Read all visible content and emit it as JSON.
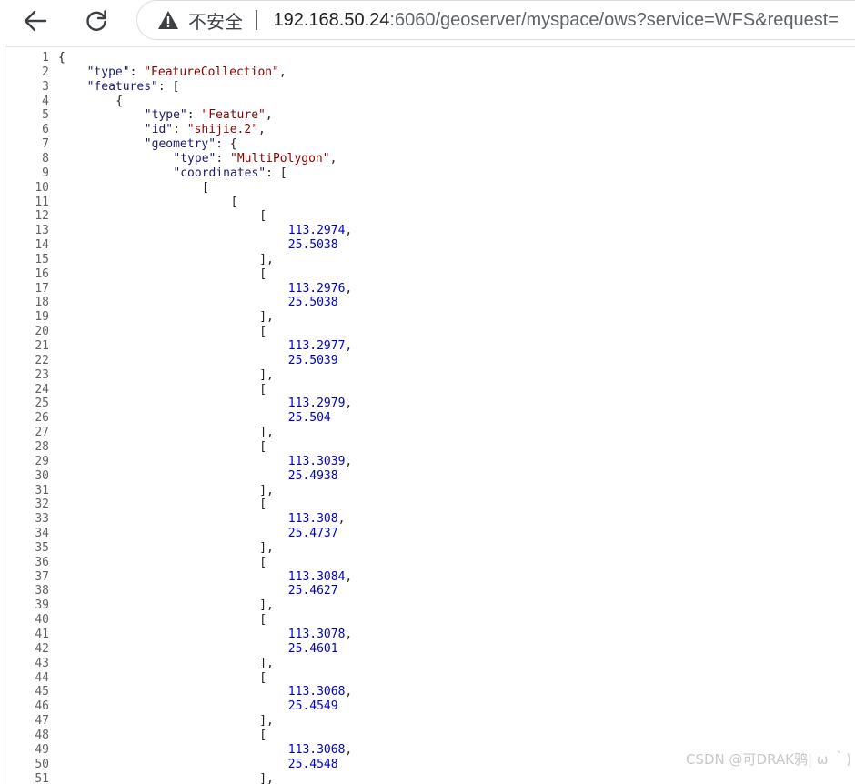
{
  "toolbar": {
    "back_icon": "arrow-left-icon",
    "reload_icon": "reload-icon",
    "security_icon": "warning-triangle-icon",
    "security_label": "不安全",
    "url_host": "192.168.50.24",
    "url_rest": ":6060/geoserver/myspace/ows?service=WFS&request="
  },
  "code_lines": [
    {
      "n": "1",
      "i": 0,
      "t": [
        [
          "p",
          "{"
        ]
      ]
    },
    {
      "n": "2",
      "i": 4,
      "t": [
        [
          "k",
          "\"type\""
        ],
        [
          "p",
          ": "
        ],
        [
          "s",
          "\"FeatureCollection\""
        ],
        [
          "p",
          ","
        ]
      ]
    },
    {
      "n": "3",
      "i": 4,
      "t": [
        [
          "k",
          "\"features\""
        ],
        [
          "p",
          ": ["
        ]
      ]
    },
    {
      "n": "4",
      "i": 8,
      "t": [
        [
          "p",
          "{"
        ]
      ]
    },
    {
      "n": "5",
      "i": 12,
      "t": [
        [
          "k",
          "\"type\""
        ],
        [
          "p",
          ": "
        ],
        [
          "s",
          "\"Feature\""
        ],
        [
          "p",
          ","
        ]
      ]
    },
    {
      "n": "6",
      "i": 12,
      "t": [
        [
          "k",
          "\"id\""
        ],
        [
          "p",
          ": "
        ],
        [
          "s",
          "\"shijie.2\""
        ],
        [
          "p",
          ","
        ]
      ]
    },
    {
      "n": "7",
      "i": 12,
      "t": [
        [
          "k",
          "\"geometry\""
        ],
        [
          "p",
          ": {"
        ]
      ]
    },
    {
      "n": "8",
      "i": 16,
      "t": [
        [
          "k",
          "\"type\""
        ],
        [
          "p",
          ": "
        ],
        [
          "s",
          "\"MultiPolygon\""
        ],
        [
          "p",
          ","
        ]
      ]
    },
    {
      "n": "9",
      "i": 16,
      "t": [
        [
          "k",
          "\"coordinates\""
        ],
        [
          "p",
          ": ["
        ]
      ]
    },
    {
      "n": "10",
      "i": 20,
      "t": [
        [
          "p",
          "["
        ]
      ]
    },
    {
      "n": "11",
      "i": 24,
      "t": [
        [
          "p",
          "["
        ]
      ]
    },
    {
      "n": "12",
      "i": 28,
      "t": [
        [
          "p",
          "["
        ]
      ]
    },
    {
      "n": "13",
      "i": 32,
      "t": [
        [
          "n",
          "113.2974"
        ],
        [
          "p",
          ","
        ]
      ]
    },
    {
      "n": "14",
      "i": 32,
      "t": [
        [
          "n",
          "25.5038"
        ]
      ]
    },
    {
      "n": "15",
      "i": 28,
      "t": [
        [
          "p",
          "],"
        ]
      ]
    },
    {
      "n": "16",
      "i": 28,
      "t": [
        [
          "p",
          "["
        ]
      ]
    },
    {
      "n": "17",
      "i": 32,
      "t": [
        [
          "n",
          "113.2976"
        ],
        [
          "p",
          ","
        ]
      ]
    },
    {
      "n": "18",
      "i": 32,
      "t": [
        [
          "n",
          "25.5038"
        ]
      ]
    },
    {
      "n": "19",
      "i": 28,
      "t": [
        [
          "p",
          "],"
        ]
      ]
    },
    {
      "n": "20",
      "i": 28,
      "t": [
        [
          "p",
          "["
        ]
      ]
    },
    {
      "n": "21",
      "i": 32,
      "t": [
        [
          "n",
          "113.2977"
        ],
        [
          "p",
          ","
        ]
      ]
    },
    {
      "n": "22",
      "i": 32,
      "t": [
        [
          "n",
          "25.5039"
        ]
      ]
    },
    {
      "n": "23",
      "i": 28,
      "t": [
        [
          "p",
          "],"
        ]
      ]
    },
    {
      "n": "24",
      "i": 28,
      "t": [
        [
          "p",
          "["
        ]
      ]
    },
    {
      "n": "25",
      "i": 32,
      "t": [
        [
          "n",
          "113.2979"
        ],
        [
          "p",
          ","
        ]
      ]
    },
    {
      "n": "26",
      "i": 32,
      "t": [
        [
          "n",
          "25.504"
        ]
      ]
    },
    {
      "n": "27",
      "i": 28,
      "t": [
        [
          "p",
          "],"
        ]
      ]
    },
    {
      "n": "28",
      "i": 28,
      "t": [
        [
          "p",
          "["
        ]
      ]
    },
    {
      "n": "29",
      "i": 32,
      "t": [
        [
          "n",
          "113.3039"
        ],
        [
          "p",
          ","
        ]
      ]
    },
    {
      "n": "30",
      "i": 32,
      "t": [
        [
          "n",
          "25.4938"
        ]
      ]
    },
    {
      "n": "31",
      "i": 28,
      "t": [
        [
          "p",
          "],"
        ]
      ]
    },
    {
      "n": "32",
      "i": 28,
      "t": [
        [
          "p",
          "["
        ]
      ]
    },
    {
      "n": "33",
      "i": 32,
      "t": [
        [
          "n",
          "113.308"
        ],
        [
          "p",
          ","
        ]
      ]
    },
    {
      "n": "34",
      "i": 32,
      "t": [
        [
          "n",
          "25.4737"
        ]
      ]
    },
    {
      "n": "35",
      "i": 28,
      "t": [
        [
          "p",
          "],"
        ]
      ]
    },
    {
      "n": "36",
      "i": 28,
      "t": [
        [
          "p",
          "["
        ]
      ]
    },
    {
      "n": "37",
      "i": 32,
      "t": [
        [
          "n",
          "113.3084"
        ],
        [
          "p",
          ","
        ]
      ]
    },
    {
      "n": "38",
      "i": 32,
      "t": [
        [
          "n",
          "25.4627"
        ]
      ]
    },
    {
      "n": "39",
      "i": 28,
      "t": [
        [
          "p",
          "],"
        ]
      ]
    },
    {
      "n": "40",
      "i": 28,
      "t": [
        [
          "p",
          "["
        ]
      ]
    },
    {
      "n": "41",
      "i": 32,
      "t": [
        [
          "n",
          "113.3078"
        ],
        [
          "p",
          ","
        ]
      ]
    },
    {
      "n": "42",
      "i": 32,
      "t": [
        [
          "n",
          "25.4601"
        ]
      ]
    },
    {
      "n": "43",
      "i": 28,
      "t": [
        [
          "p",
          "],"
        ]
      ]
    },
    {
      "n": "44",
      "i": 28,
      "t": [
        [
          "p",
          "["
        ]
      ]
    },
    {
      "n": "45",
      "i": 32,
      "t": [
        [
          "n",
          "113.3068"
        ],
        [
          "p",
          ","
        ]
      ]
    },
    {
      "n": "46",
      "i": 32,
      "t": [
        [
          "n",
          "25.4549"
        ]
      ]
    },
    {
      "n": "47",
      "i": 28,
      "t": [
        [
          "p",
          "],"
        ]
      ]
    },
    {
      "n": "48",
      "i": 28,
      "t": [
        [
          "p",
          "["
        ]
      ]
    },
    {
      "n": "49",
      "i": 32,
      "t": [
        [
          "n",
          "113.3068"
        ],
        [
          "p",
          ","
        ]
      ]
    },
    {
      "n": "50",
      "i": 32,
      "t": [
        [
          "n",
          "25.4548"
        ]
      ]
    },
    {
      "n": "51",
      "i": 28,
      "t": [
        [
          "p",
          "],"
        ]
      ]
    }
  ],
  "watermark": "CSDN @可DRAK鸦| ω ｀)"
}
